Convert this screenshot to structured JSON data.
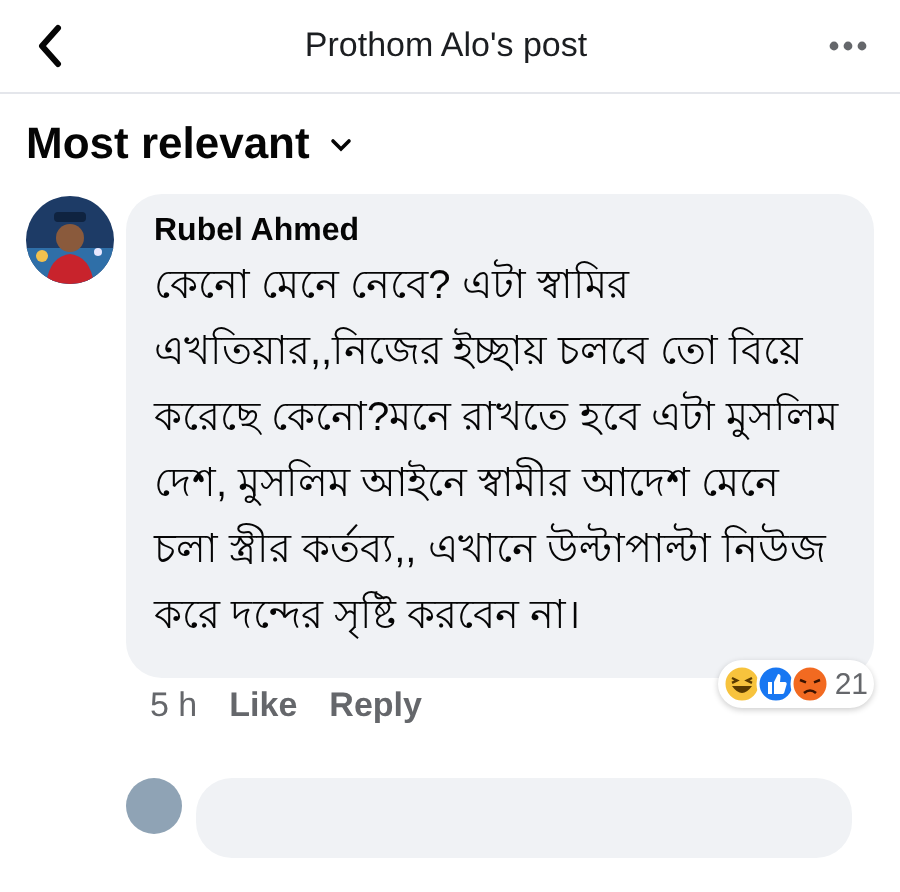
{
  "header": {
    "title": "Prothom Alo's post"
  },
  "sort": {
    "label": "Most relevant"
  },
  "comments": [
    {
      "author": "Rubel Ahmed",
      "text": "কেনো মেনে নেবে? এটা স্বামির এখতিয়ার,,নিজের ইচ্ছায় চলবে তো বিয়ে করেছে কেনো?মনে রাখতে হবে এটা মুসলিম দেশ, মুসলিম আইনে স্বামীর আদেশ মেনে চলা স্ত্রীর কর্তব্য,, এখানে উল্টাপাল্টা নিউজ করে দন্দের সৃষ্টি করবেন না।",
      "time": "5 h",
      "actions": [
        "Like",
        "Reply"
      ],
      "reactions": [
        {
          "kind": "haha"
        },
        {
          "kind": "like"
        },
        {
          "kind": "angry"
        }
      ],
      "reaction_count": "21"
    }
  ]
}
